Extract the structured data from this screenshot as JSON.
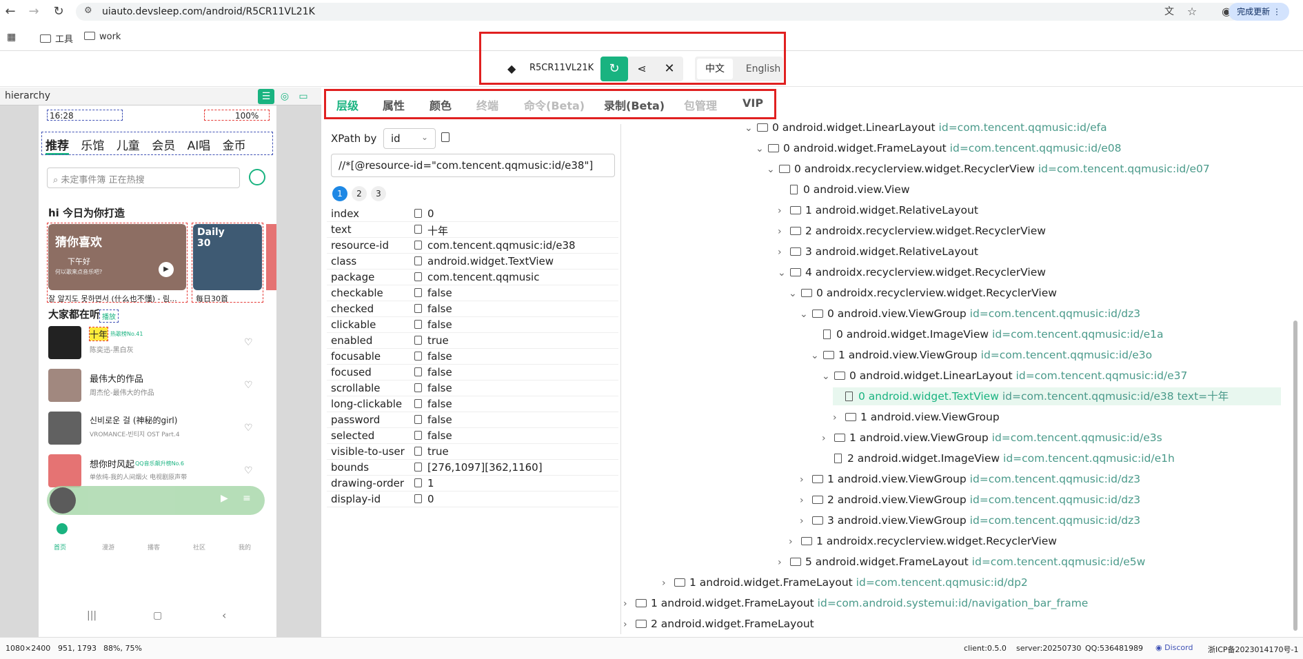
{
  "browser": {
    "url": "uiauto.devsleep.com/android/R5CR11VL21K",
    "update_label": "完成更新",
    "bookmarks": [
      "工具",
      "work"
    ]
  },
  "device": {
    "serial": "R5CR11VL21K",
    "lang_zh": "中文",
    "lang_en": "English"
  },
  "hierarchy": {
    "title": "hierarchy",
    "phone": {
      "time": "16:28",
      "battery": "100%",
      "tabs": [
        "推荐",
        "乐馆",
        "儿童",
        "会员",
        "AI唱",
        "金币"
      ],
      "search_placeholder": "未定事件簿",
      "search_hint": "正在热搜",
      "greeting": "hi 今日为你打造",
      "card1_title": "猜你喜欢",
      "card1_sub": "下午好",
      "card1_sub2": "何以歌来点音乐吧?",
      "card1_caption": "잘 알지도 못하면서 (什么也不懂) - 림...",
      "card2_title": "Daily 30",
      "card2_caption": "每日30首",
      "section2": "大家都在听",
      "section2_badge": "播放",
      "songs": [
        {
          "title": "十年",
          "tag": "热歌榜No.41",
          "artist": "陈奕迅-黑白灰"
        },
        {
          "title": "最伟大的作品",
          "tag": "",
          "artist": "周杰伦-最伟大的作品"
        },
        {
          "title": "신비로운 걸 (神秘的girl)",
          "tag": "",
          "artist": "VROMANCE-빈티지 OST Part.4"
        },
        {
          "title": "想你时风起",
          "tag": "QQ音乐飙升榜No.6",
          "artist": "单依纯-我的人间烟火 电视剧原声带"
        }
      ],
      "bottom_nav": [
        "首页",
        "漫游",
        "播客",
        "社区",
        "我的"
      ]
    }
  },
  "tabs": [
    "层级",
    "属性",
    "颜色",
    "终端",
    "命令(Beta)",
    "录制(Beta)",
    "包管理",
    "VIP"
  ],
  "xpath": {
    "label": "XPath by",
    "select": "id",
    "value": "//*[@resource-id=\"com.tencent.qqmusic:id/e38\"]",
    "pages": [
      "1",
      "2",
      "3"
    ]
  },
  "props": [
    {
      "k": "index",
      "v": "0"
    },
    {
      "k": "text",
      "v": "十年"
    },
    {
      "k": "resource-id",
      "v": "com.tencent.qqmusic:id/e38"
    },
    {
      "k": "class",
      "v": "android.widget.TextView"
    },
    {
      "k": "package",
      "v": "com.tencent.qqmusic"
    },
    {
      "k": "checkable",
      "v": "false"
    },
    {
      "k": "checked",
      "v": "false"
    },
    {
      "k": "clickable",
      "v": "false"
    },
    {
      "k": "enabled",
      "v": "true"
    },
    {
      "k": "focusable",
      "v": "false"
    },
    {
      "k": "focused",
      "v": "false"
    },
    {
      "k": "scrollable",
      "v": "false"
    },
    {
      "k": "long-clickable",
      "v": "false"
    },
    {
      "k": "password",
      "v": "false"
    },
    {
      "k": "selected",
      "v": "false"
    },
    {
      "k": "visible-to-user",
      "v": "true"
    },
    {
      "k": "bounds",
      "v": "[276,1097][362,1160]"
    },
    {
      "k": "drawing-order",
      "v": "1"
    },
    {
      "k": "display-id",
      "v": "0"
    }
  ],
  "tree": [
    {
      "indent": 1080,
      "chev": "v",
      "icon": "folder",
      "label": "0 android.widget.LinearLayout",
      "id": "id=com.tencent.qqmusic:id/efa"
    },
    {
      "indent": 1096,
      "chev": "v",
      "icon": "folder",
      "label": "0 android.widget.FrameLayout",
      "id": "id=com.tencent.qqmusic:id/e08"
    },
    {
      "indent": 1112,
      "chev": "v",
      "icon": "folder",
      "label": "0 androidx.recyclerview.widget.RecyclerView",
      "id": "id=com.tencent.qqmusic:id/e07"
    },
    {
      "indent": 1128,
      "chev": "",
      "icon": "file",
      "label": "0 android.view.View",
      "id": ""
    },
    {
      "indent": 1128,
      "chev": ">",
      "icon": "folder",
      "label": "1 android.widget.RelativeLayout",
      "id": ""
    },
    {
      "indent": 1128,
      "chev": ">",
      "icon": "folder",
      "label": "2 androidx.recyclerview.widget.RecyclerView",
      "id": ""
    },
    {
      "indent": 1128,
      "chev": ">",
      "icon": "folder",
      "label": "3 android.widget.RelativeLayout",
      "id": ""
    },
    {
      "indent": 1128,
      "chev": "v",
      "icon": "folder",
      "label": "4 androidx.recyclerview.widget.RecyclerView",
      "id": ""
    },
    {
      "indent": 1144,
      "chev": "v",
      "icon": "folder",
      "label": "0 androidx.recyclerview.widget.RecyclerView",
      "id": ""
    },
    {
      "indent": 1160,
      "chev": "v",
      "icon": "folder",
      "label": "0 android.view.ViewGroup",
      "id": "id=com.tencent.qqmusic:id/dz3"
    },
    {
      "indent": 1176,
      "chev": "",
      "icon": "file",
      "label": "0 android.widget.ImageView",
      "id": "id=com.tencent.qqmusic:id/e1a"
    },
    {
      "indent": 1176,
      "chev": "v",
      "icon": "folder",
      "label": "1 android.view.ViewGroup",
      "id": "id=com.tencent.qqmusic:id/e3o"
    },
    {
      "indent": 1192,
      "chev": "v",
      "icon": "folder",
      "label": "0 android.widget.LinearLayout",
      "id": "id=com.tencent.qqmusic:id/e37"
    },
    {
      "indent": 1208,
      "chev": "",
      "icon": "file",
      "label": "0 android.widget.TextView",
      "id": "id=com.tencent.qqmusic:id/e38 text=十年",
      "selected": true
    },
    {
      "indent": 1208,
      "chev": ">",
      "icon": "folder",
      "label": "1 android.view.ViewGroup",
      "id": ""
    },
    {
      "indent": 1192,
      "chev": ">",
      "icon": "folder",
      "label": "1 android.view.ViewGroup",
      "id": "id=com.tencent.qqmusic:id/e3s"
    },
    {
      "indent": 1192,
      "chev": "",
      "icon": "file",
      "label": "2 android.widget.ImageView",
      "id": "id=com.tencent.qqmusic:id/e1h"
    },
    {
      "indent": 1160,
      "chev": ">",
      "icon": "folder",
      "label": "1 android.view.ViewGroup",
      "id": "id=com.tencent.qqmusic:id/dz3"
    },
    {
      "indent": 1160,
      "chev": ">",
      "icon": "folder",
      "label": "2 android.view.ViewGroup",
      "id": "id=com.tencent.qqmusic:id/dz3"
    },
    {
      "indent": 1160,
      "chev": ">",
      "icon": "folder",
      "label": "3 android.view.ViewGroup",
      "id": "id=com.tencent.qqmusic:id/dz3"
    },
    {
      "indent": 1144,
      "chev": ">",
      "icon": "folder",
      "label": "1 androidx.recyclerview.widget.RecyclerView",
      "id": ""
    },
    {
      "indent": 1128,
      "chev": ">",
      "icon": "folder",
      "label": "5 android.widget.FrameLayout",
      "id": "id=com.tencent.qqmusic:id/e5w"
    },
    {
      "indent": 960,
      "chev": ">",
      "icon": "folder",
      "label": "1 android.widget.FrameLayout",
      "id": "id=com.tencent.qqmusic:id/dp2"
    },
    {
      "indent": 904,
      "chev": ">",
      "icon": "folder",
      "label": "1 android.widget.FrameLayout",
      "id": "id=com.android.systemui:id/navigation_bar_frame"
    },
    {
      "indent": 904,
      "chev": ">",
      "icon": "folder",
      "label": "2 android.widget.FrameLayout",
      "id": ""
    }
  ],
  "status": {
    "resolution": "1080×2400",
    "coords": "951, 1793",
    "percent": "88%, 75%",
    "client": "client:0.5.0",
    "server": "server:20250730",
    "qq": "QQ:536481989",
    "discord": "Discord",
    "icp": "浙ICP备2023014170号-1"
  },
  "colors": {
    "accent": "#19b380",
    "highlight": "#e8f7ef",
    "red_box": "#e02020",
    "tree_id": "#4a9a8a"
  }
}
